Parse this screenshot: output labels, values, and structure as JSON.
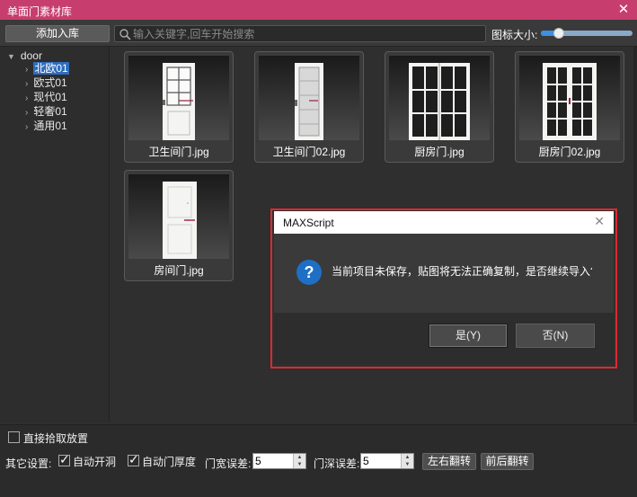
{
  "window": {
    "title": "单面门素材库",
    "close_glyph": "✕"
  },
  "toolbar": {
    "add_label": "添加入库",
    "search_placeholder": "输入关键字,回车开始搜索",
    "icon_size_label": "图标大小:",
    "icon_size_value": 0.2
  },
  "tree": {
    "root": "door",
    "items": [
      {
        "label": "北欧01",
        "selected": true
      },
      {
        "label": "欧式01",
        "selected": false
      },
      {
        "label": "现代01",
        "selected": false
      },
      {
        "label": "轻奢01",
        "selected": false
      },
      {
        "label": "通用01",
        "selected": false
      }
    ]
  },
  "thumbnails": [
    {
      "label": "卫生间门.jpg",
      "icon": "glass-panel-door-image"
    },
    {
      "label": "卫生间门02.jpg",
      "icon": "frosted-glass-door-image"
    },
    {
      "label": "厨房门.jpg",
      "icon": "double-glass-door-image"
    },
    {
      "label": "厨房门02.jpg",
      "icon": "double-grid-door-image"
    },
    {
      "label": "房间门.jpg",
      "icon": "plain-room-door-image"
    }
  ],
  "dialog": {
    "title": "MAXScript",
    "close_glyph": "✕",
    "icon": "question-icon",
    "message": "当前项目未保存，贴图将无法正确复制，是否继续导入?",
    "yes_label": "是(Y)",
    "no_label": "否(N)"
  },
  "bottom": {
    "pick_label": "直接拾取放置",
    "pick_checked": false,
    "other_label": "其它设置:",
    "auto_open_label": "自动开洞",
    "auto_open_checked": true,
    "auto_thick_label": "自动门厚度",
    "auto_thick_checked": true,
    "width_tol_label": "门宽误差:",
    "width_tol_value": "5",
    "depth_tol_label": "门深误差:",
    "depth_tol_value": "5",
    "flip_lr_label": "左右翻转",
    "flip_fb_label": "前后翻转"
  },
  "colors": {
    "title_bar": "#c73e6e",
    "selection": "#2f6dbd",
    "highlight_outline": "#e0282f",
    "accent_blue": "#3d8fe0"
  }
}
